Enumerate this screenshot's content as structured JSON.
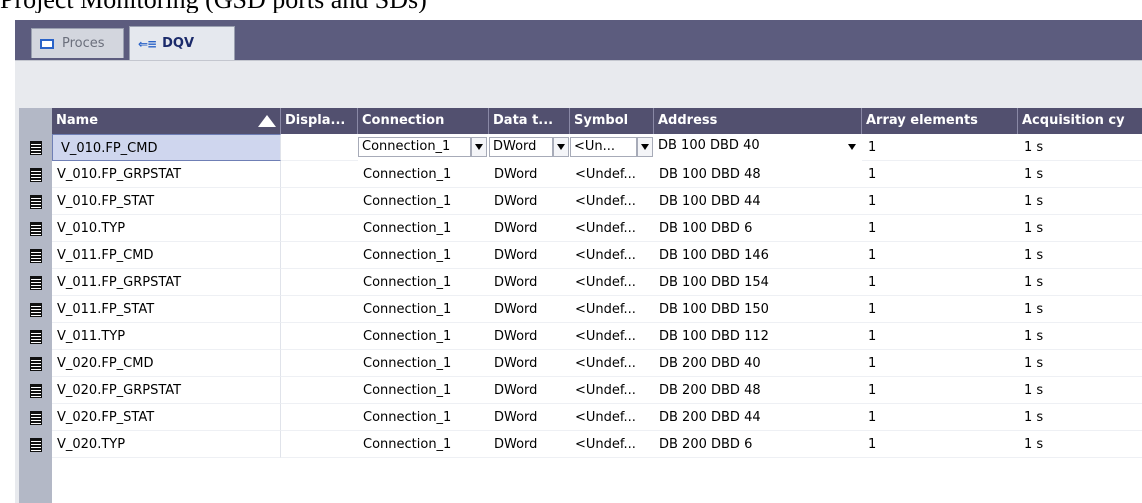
{
  "caption": "Project Monitoring (GSD ports and SDs)",
  "tabs": [
    {
      "label": "Proces",
      "active": false,
      "icon": "window-icon"
    },
    {
      "label": "DQV",
      "active": true,
      "icon": "list-icon"
    }
  ],
  "table": {
    "columns": [
      "Name",
      "Displa...",
      "Connection",
      "Data t...",
      "Symbol",
      "Address",
      "Array elements",
      "Acquisition cy"
    ],
    "sort_column": "Name",
    "sort_direction": "ascending",
    "selected_row": 0,
    "rows": [
      {
        "name": "V_010.FP_CMD",
        "display": "",
        "connection": "Connection_1",
        "datatype": "DWord",
        "symbol": "<Un...",
        "address": "DB 100 DBD 40",
        "array": "1",
        "acq": "1 s"
      },
      {
        "name": "V_010.FP_GRPSTAT",
        "display": "",
        "connection": "Connection_1",
        "datatype": "DWord",
        "symbol": "<Undef...",
        "address": "DB 100 DBD 48",
        "array": "1",
        "acq": "1 s"
      },
      {
        "name": "V_010.FP_STAT",
        "display": "",
        "connection": "Connection_1",
        "datatype": "DWord",
        "symbol": "<Undef...",
        "address": "DB 100 DBD 44",
        "array": "1",
        "acq": "1 s"
      },
      {
        "name": "V_010.TYP",
        "display": "",
        "connection": "Connection_1",
        "datatype": "DWord",
        "symbol": "<Undef...",
        "address": "DB 100 DBD 6",
        "array": "1",
        "acq": "1 s"
      },
      {
        "name": "V_011.FP_CMD",
        "display": "",
        "connection": "Connection_1",
        "datatype": "DWord",
        "symbol": "<Undef...",
        "address": "DB 100 DBD 146",
        "array": "1",
        "acq": "1 s"
      },
      {
        "name": "V_011.FP_GRPSTAT",
        "display": "",
        "connection": "Connection_1",
        "datatype": "DWord",
        "symbol": "<Undef...",
        "address": "DB 100 DBD 154",
        "array": "1",
        "acq": "1 s"
      },
      {
        "name": "V_011.FP_STAT",
        "display": "",
        "connection": "Connection_1",
        "datatype": "DWord",
        "symbol": "<Undef...",
        "address": "DB 100 DBD 150",
        "array": "1",
        "acq": "1 s"
      },
      {
        "name": "V_011.TYP",
        "display": "",
        "connection": "Connection_1",
        "datatype": "DWord",
        "symbol": "<Undef...",
        "address": "DB 100 DBD 112",
        "array": "1",
        "acq": "1 s"
      },
      {
        "name": "V_020.FP_CMD",
        "display": "",
        "connection": "Connection_1",
        "datatype": "DWord",
        "symbol": "<Undef...",
        "address": "DB 200 DBD 40",
        "array": "1",
        "acq": "1 s"
      },
      {
        "name": "V_020.FP_GRPSTAT",
        "display": "",
        "connection": "Connection_1",
        "datatype": "DWord",
        "symbol": "<Undef...",
        "address": "DB 200 DBD 48",
        "array": "1",
        "acq": "1 s"
      },
      {
        "name": "V_020.FP_STAT",
        "display": "",
        "connection": "Connection_1",
        "datatype": "DWord",
        "symbol": "<Undef...",
        "address": "DB 200 DBD 44",
        "array": "1",
        "acq": "1 s"
      },
      {
        "name": "V_020.TYP",
        "display": "",
        "connection": "Connection_1",
        "datatype": "DWord",
        "symbol": "<Undef...",
        "address": "DB 200 DBD 6",
        "array": "1",
        "acq": "1 s"
      }
    ]
  }
}
